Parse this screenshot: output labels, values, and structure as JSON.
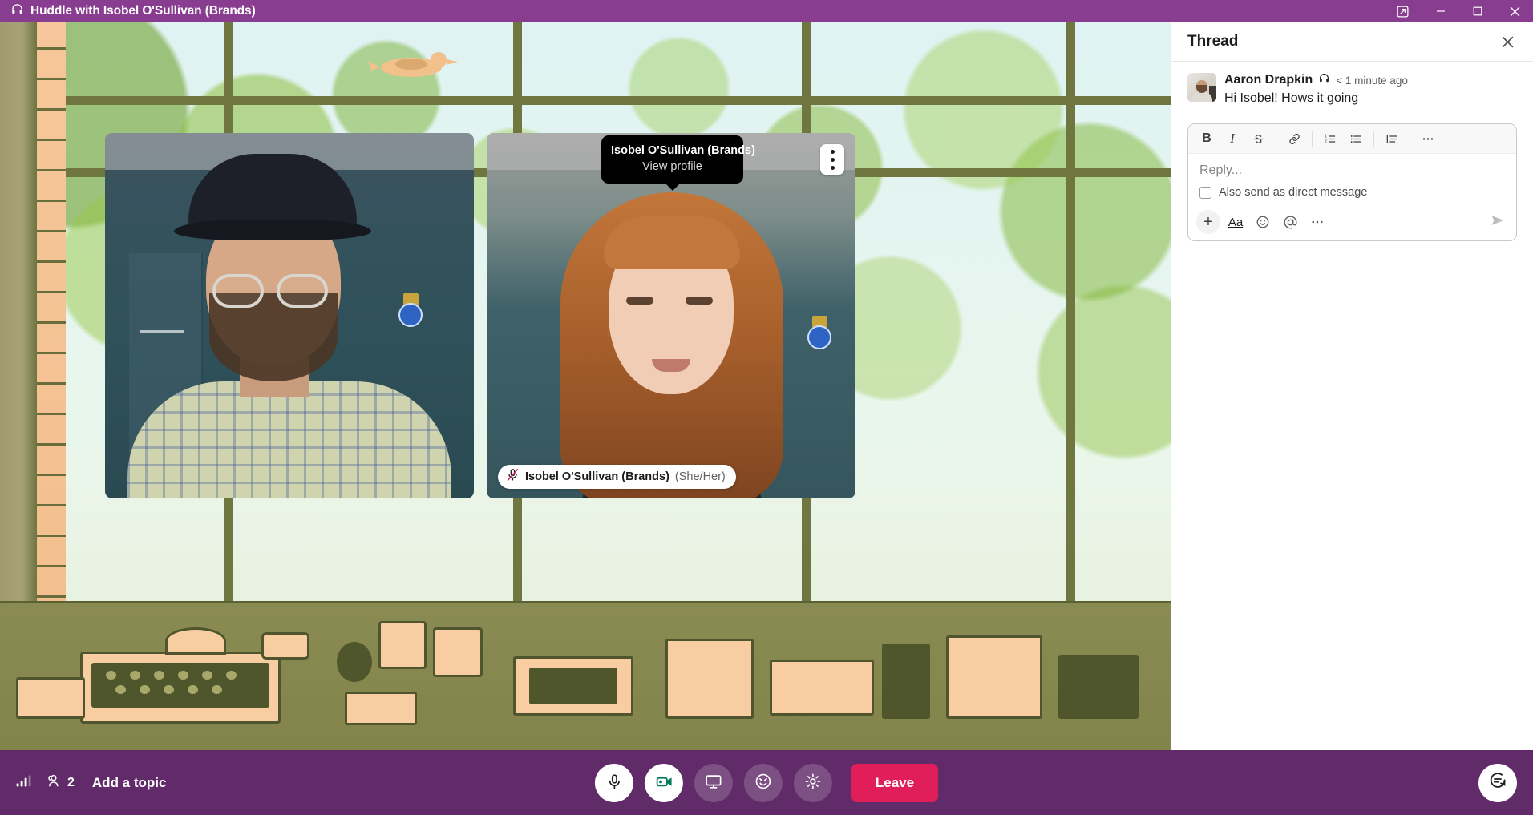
{
  "window": {
    "title": "Huddle with Isobel O'Sullivan (Brands)",
    "title_icon": "headphones-icon",
    "header_color": "#883d91",
    "controls": {
      "popout": "popout-icon",
      "minimize": "minimize-icon",
      "maximize": "maximize-icon",
      "close": "close-icon"
    }
  },
  "stage": {
    "tiles": [
      {
        "id": "self",
        "participant": "Aaron Drapkin",
        "badge_visible": false
      },
      {
        "id": "other",
        "participant": "Isobel O'Sullivan (Brands)",
        "badge_visible": true,
        "badge_name": "Isobel O'Sullivan (Brands)",
        "badge_pronouns": "(She/Her)",
        "badge_icon": "mic-muted-icon",
        "kebab_label": "more-options-icon"
      }
    ],
    "tooltip": {
      "name": "Isobel O'Sullivan (Brands)",
      "action": "View profile"
    }
  },
  "controlbar": {
    "background": "#612a69",
    "signal_icon": "signal-bars-icon",
    "people_icon": "people-icon",
    "people_count": "2",
    "topic_label": "Add a topic",
    "buttons": [
      {
        "name": "mic-button",
        "icon": "microphone-icon",
        "style": "white"
      },
      {
        "name": "video-button",
        "icon": "video-camera-icon",
        "style": "white"
      },
      {
        "name": "screen-share-button",
        "icon": "screen-icon",
        "style": "ghost"
      },
      {
        "name": "reaction-button",
        "icon": "smiley-icon",
        "style": "ghost"
      },
      {
        "name": "settings-button",
        "icon": "gear-icon",
        "style": "ghost"
      }
    ],
    "leave_label": "Leave",
    "leave_color": "#e01e5a",
    "chat_fab_icon": "chat-bubble-icon"
  },
  "thread": {
    "title": "Thread",
    "close_icon": "close-icon",
    "message": {
      "author": "Aaron Drapkin",
      "author_icon": "headphones-icon",
      "timestamp": "< 1 minute ago",
      "text": "Hi Isobel! Hows it going",
      "avatar": "user-avatar"
    },
    "composer": {
      "placeholder": "Reply...",
      "value": "",
      "toolbar": [
        {
          "name": "bold-button",
          "label": "B"
        },
        {
          "name": "italic-button",
          "label": "I"
        },
        {
          "name": "strikethrough-button",
          "label": "S"
        },
        {
          "name": "link-button",
          "label": "link-icon"
        },
        {
          "name": "ordered-list-button",
          "label": "ordered-list-icon"
        },
        {
          "name": "bulleted-list-button",
          "label": "bulleted-list-icon"
        },
        {
          "name": "blockquote-button",
          "label": "blockquote-icon"
        },
        {
          "name": "more-formatting-button",
          "label": "ellipsis-icon"
        }
      ],
      "checkbox_label": "Also send as direct message",
      "checkbox_checked": false,
      "actions": [
        {
          "name": "attach-button",
          "label": "+"
        },
        {
          "name": "formatting-button",
          "label": "Aa"
        },
        {
          "name": "emoji-button",
          "label": "emoji-icon"
        },
        {
          "name": "mention-button",
          "label": "at-icon"
        },
        {
          "name": "more-actions-button",
          "label": "ellipsis-icon"
        }
      ],
      "send_label": "send-icon"
    }
  }
}
